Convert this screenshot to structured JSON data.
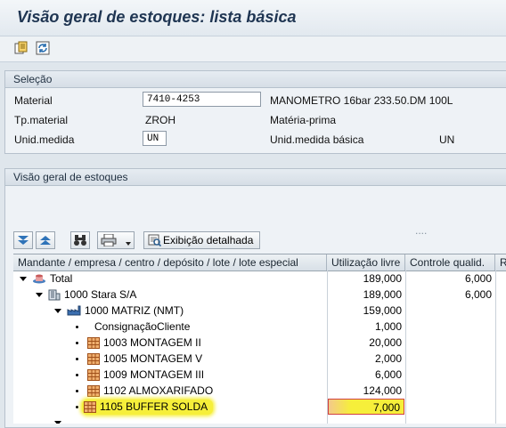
{
  "window": {
    "title": "Visão geral de estoques: lista básica"
  },
  "toolbar": {
    "icons": [
      "copy-icon",
      "refresh-icon"
    ]
  },
  "selection": {
    "heading": "Seleção",
    "material_label": "Material",
    "material_value": "7410-4253",
    "material_desc": "MANOMETRO 16bar 233.50.DM 100L",
    "type_label": "Tp.material",
    "type_value": "ZROH",
    "type_desc": "Matéria-prima",
    "unit_label": "Unid.medida",
    "unit_value": "UN",
    "base_unit_label": "Unid.medida básica",
    "base_unit_value": "UN"
  },
  "overview": {
    "heading": "Visão geral de estoques",
    "sep": "....",
    "detail_button": "Exibição detalhada"
  },
  "grid": {
    "headers": [
      "Mandante / empresa / centro / depósito / lote / lote especial",
      "Utilização livre",
      "Controle qualid.",
      "R"
    ],
    "rows": [
      {
        "name": "Total",
        "free": "189,000",
        "qc": "6,000"
      },
      {
        "name": "1000 Stara S/A",
        "free": "189,000",
        "qc": "6,000"
      },
      {
        "name": "1000 MATRIZ (NMT)",
        "free": "159,000",
        "qc": ""
      },
      {
        "name": "ConsignaçãoCliente",
        "free": "1,000",
        "qc": ""
      },
      {
        "name": "1003 MONTAGEM II",
        "free": "20,000",
        "qc": ""
      },
      {
        "name": "1005 MONTAGEM V",
        "free": "2,000",
        "qc": ""
      },
      {
        "name": "1009 MONTAGEM III",
        "free": "6,000",
        "qc": ""
      },
      {
        "name": "1102 ALMOXARIFADO",
        "free": "124,000",
        "qc": ""
      },
      {
        "name": "1105 BUFFER SOLDA",
        "free": "7,000",
        "qc": ""
      }
    ],
    "highlight_color": "#f6ef3a"
  }
}
